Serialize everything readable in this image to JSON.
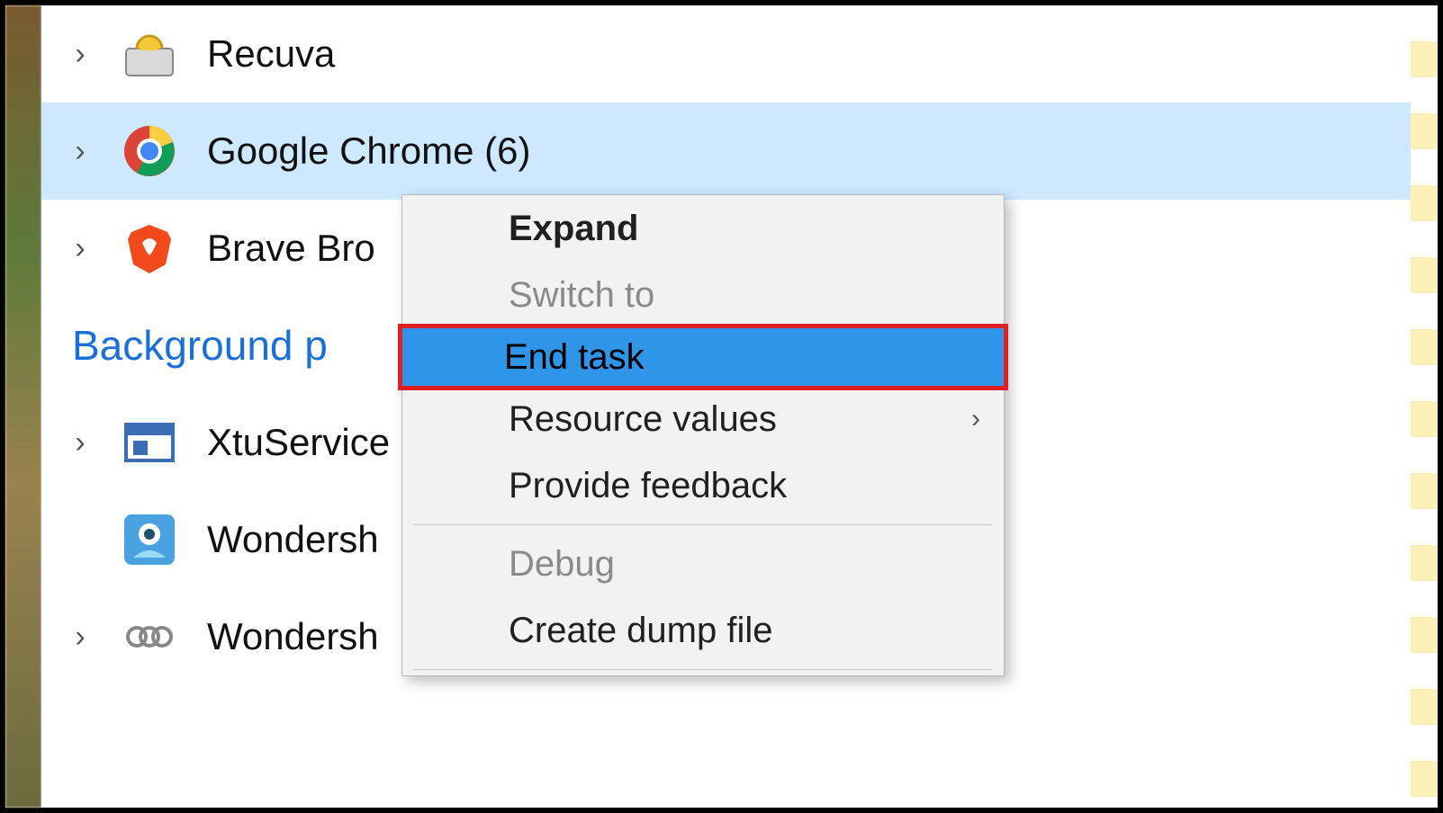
{
  "processes": [
    {
      "name": "Recuva",
      "count": null
    },
    {
      "name": "Google Chrome",
      "count": 6
    },
    {
      "name": "Brave Bro",
      "count": null
    }
  ],
  "section_label": "Background p",
  "background": [
    {
      "name": "XtuService"
    },
    {
      "name": "Wondersh"
    },
    {
      "name": "Wondersh"
    }
  ],
  "context_menu": {
    "expand": "Expand",
    "switch_to": "Switch to",
    "end_task": "End task",
    "resource_values": "Resource values",
    "provide_feedback": "Provide feedback",
    "debug": "Debug",
    "create_dump": "Create dump file"
  }
}
